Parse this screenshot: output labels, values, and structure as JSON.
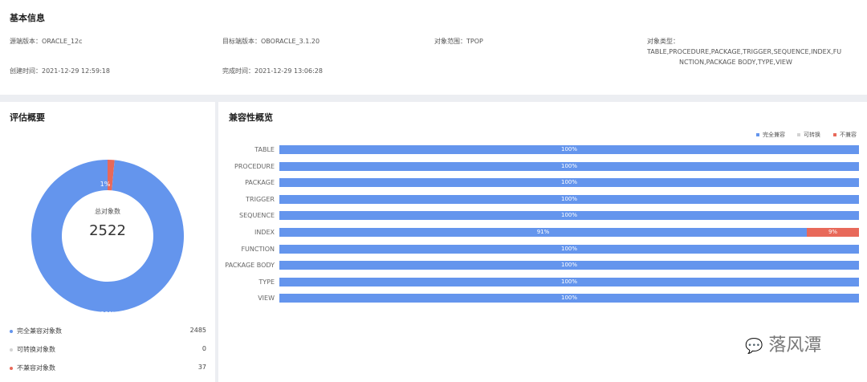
{
  "basic": {
    "title": "基本信息",
    "source_version": "源端版本：ORACLE_12c",
    "target_version": "目标端版本：OBORACLE_3.1.20",
    "object_scope": "对象范围：TPOP",
    "object_type_line1": "对象类型：TABLE,PROCEDURE,PACKAGE,TRIGGER,SEQUENCE,INDEX,FU",
    "object_type_line2": "NCTION,PACKAGE BODY,TYPE,VIEW",
    "created_time": "创建时间：2021-12-29 12:59:18",
    "finished_time": "完成时间：2021-12-29 13:06:28"
  },
  "overview": {
    "title": "评估概要",
    "center_label": "总对象数",
    "total": "2522",
    "legend": [
      {
        "label": "完全兼容对象数",
        "count": "2485",
        "color": "#6495ed"
      },
      {
        "label": "可转换对象数",
        "count": "0",
        "color": "#d3d3d3"
      },
      {
        "label": "不兼容对象数",
        "count": "37",
        "color": "#e8695a"
      }
    ]
  },
  "compat_title": "兼容性概览",
  "colors": {
    "compatible": "#6495ed",
    "convertible": "#d3d3d3",
    "incompatible": "#e8695a"
  },
  "chart_data": [
    {
      "type": "pie",
      "labels": [
        "完全兼容对象数",
        "可转换对象数",
        "不兼容对象数"
      ],
      "values": [
        2485,
        0,
        37
      ],
      "slice_labels": [
        "99%",
        "",
        "1%"
      ]
    },
    {
      "type": "bar",
      "orientation": "horizontal-stacked",
      "categories": [
        "TABLE",
        "PROCEDURE",
        "PACKAGE",
        "TRIGGER",
        "SEQUENCE",
        "INDEX",
        "FUNCTION",
        "PACKAGE BODY",
        "TYPE",
        "VIEW"
      ],
      "series": [
        {
          "name": "完全兼容",
          "values": [
            100,
            100,
            100,
            100,
            100,
            91,
            100,
            100,
            100,
            100
          ]
        },
        {
          "name": "可转换",
          "values": [
            0,
            0,
            0,
            0,
            0,
            0,
            0,
            0,
            0,
            0
          ]
        },
        {
          "name": "不兼容",
          "values": [
            0,
            0,
            0,
            0,
            0,
            9,
            0,
            0,
            0,
            0
          ]
        }
      ],
      "legend_position": "top-right"
    }
  ],
  "watermark": "落风潭"
}
